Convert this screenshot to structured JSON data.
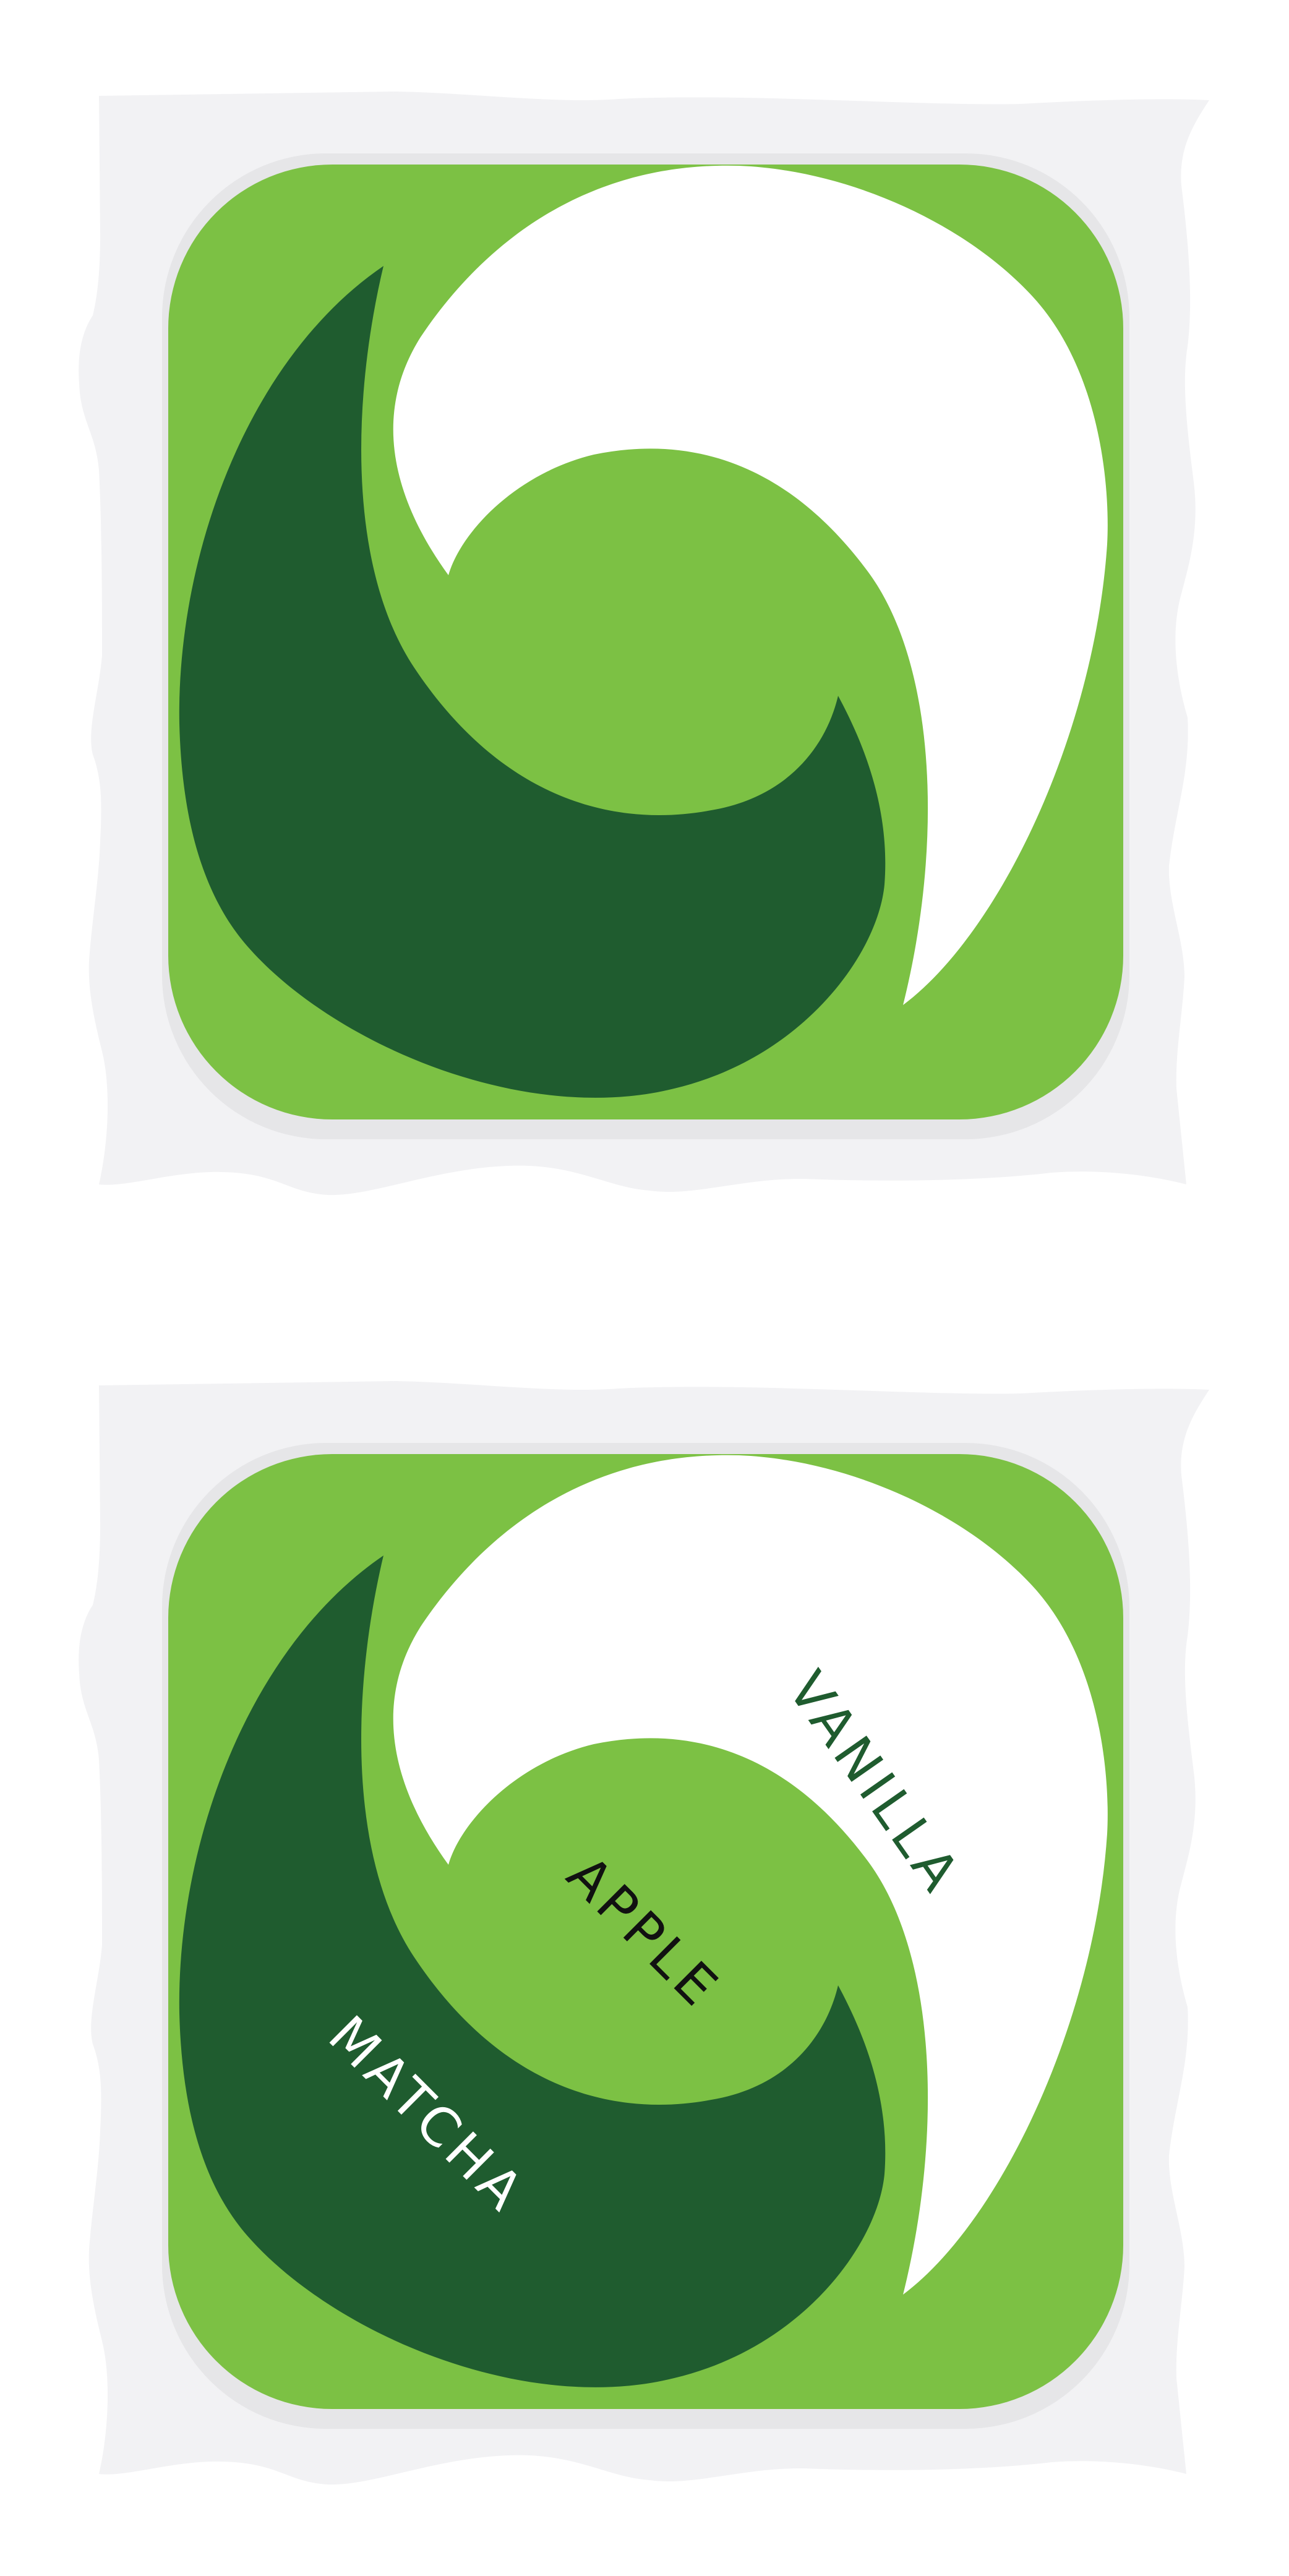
{
  "colors": {
    "background": "#ffffff",
    "paper": "#f2f2f4",
    "tile_shadow": "#e6e6e8",
    "light_green": "#7cc144",
    "dark_green": "#1f5c2f",
    "white": "#ffffff",
    "label_dark_green": "#1f5c2f",
    "label_black": "#111111",
    "label_white": "#ffffff"
  },
  "panels": [
    {
      "id": "plain-logo",
      "labels": []
    },
    {
      "id": "labeled-logo",
      "labels": [
        {
          "key": "vanilla",
          "text": "VANILLA"
        },
        {
          "key": "apple",
          "text": "APPLE"
        },
        {
          "key": "matcha",
          "text": "MATCHA"
        }
      ]
    }
  ]
}
